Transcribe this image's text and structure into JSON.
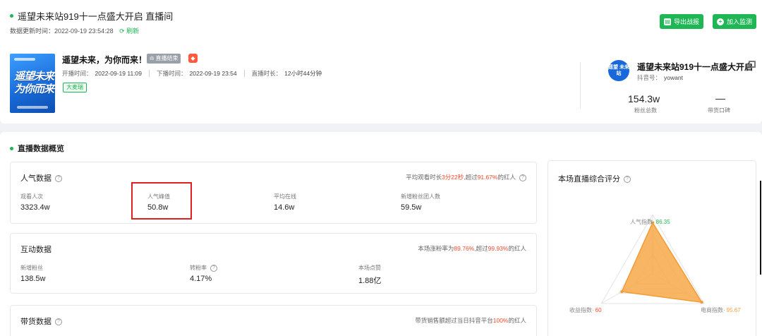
{
  "header": {
    "room_title": "遥望未来站919十一点盛大开启 直播间",
    "update_label": "数据更新时间：",
    "update_time": "2022-09-19 23:54:28",
    "refresh_label": "刷新",
    "export_label": "导出战报",
    "monitor_label": "加入监测"
  },
  "live": {
    "cover_text": "遥望未来 为你而来",
    "title": "遥望未来，为你而来！",
    "status_badge": "直播结束",
    "start_label": "开播时间：",
    "start_time": "2022-09-19 11:09",
    "end_label": "下播时间：",
    "end_time": "2022-09-19 23:54",
    "duration_label": "直播时长：",
    "duration": "12小时44分钟",
    "tag": "大麦瑞"
  },
  "anchor": {
    "avatar_text": "遥望 未来站",
    "name": "遥望未来站919十一点盛大开启",
    "id_label": "抖音号：",
    "id": "yowant",
    "fans_value": "154.3w",
    "fans_label": "粉丝总数",
    "revenue_value": "—",
    "revenue_label": "带货口碑"
  },
  "overview": {
    "title": "直播数据概览",
    "popularity": {
      "title": "人气数据",
      "summary_prefix": "平均观看时长",
      "summary_hl1": "3分22秒",
      "summary_mid": ",超过",
      "summary_hl2": "91.67%",
      "summary_suffix": "的红人",
      "metrics": [
        {
          "label": "观看人次",
          "value": "3323.4w"
        },
        {
          "label": "人气峰值",
          "value": "50.8w"
        },
        {
          "label": "平均在线",
          "value": "14.6w"
        },
        {
          "label": "新增粉丝团人数",
          "value": "59.5w"
        }
      ]
    },
    "interaction": {
      "title": "互动数据",
      "summary_prefix": "本场涨粉率为",
      "summary_hl1": "89.76%",
      "summary_mid": ",超过",
      "summary_hl2": "99.93%",
      "summary_suffix": "的红人",
      "metrics": [
        {
          "label": "新增粉丝",
          "value": "138.5w"
        },
        {
          "label": "转粉率",
          "value": "4.17%"
        },
        {
          "label": "本场点赞",
          "value": "1.88亿"
        }
      ]
    },
    "sales": {
      "title": "带货数据",
      "summary_prefix": "带货销售额超过当日抖音平台",
      "summary_hl1": "100%",
      "summary_suffix": "的红人"
    },
    "score": {
      "title": "本场直播综合评分",
      "axes": [
        {
          "label": "人气指数",
          "value": 86.35,
          "display": "86.35"
        },
        {
          "label": "电商指数",
          "value": 95.67,
          "display": "95.67"
        },
        {
          "label": "收益指数",
          "value": 60,
          "display": "60"
        }
      ],
      "fill_color": "#f7a94a"
    }
  }
}
